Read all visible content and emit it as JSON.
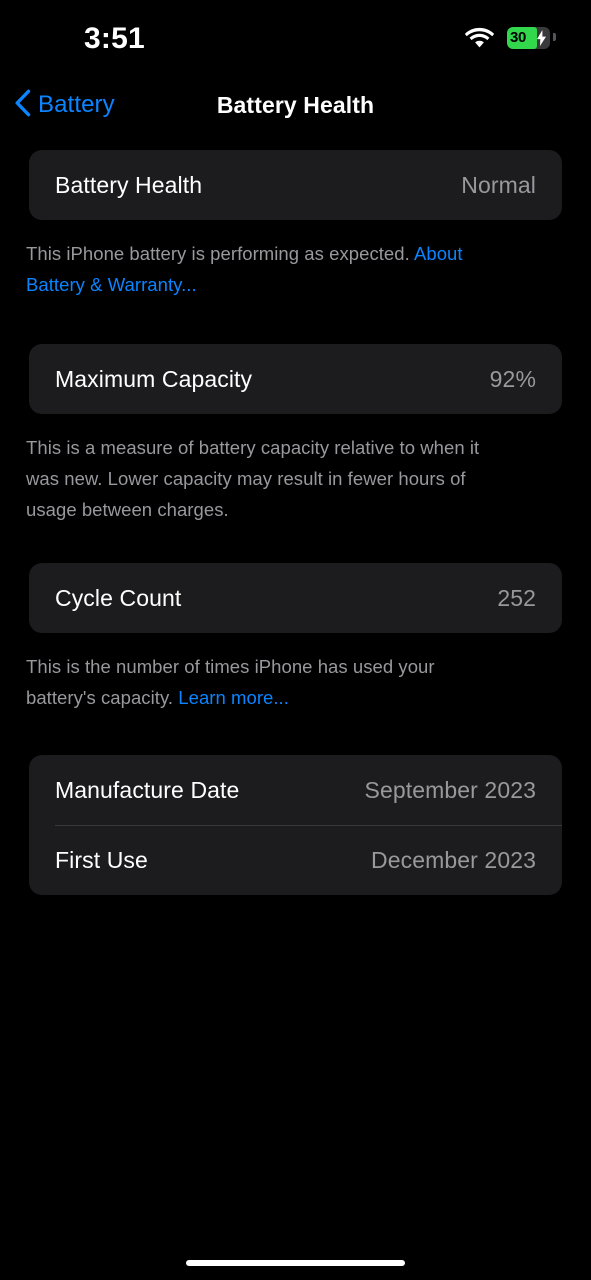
{
  "status_bar": {
    "time": "3:51",
    "wifi_icon": "wifi-icon",
    "battery": {
      "level_text": "30",
      "level_percent": 30,
      "charging": true,
      "fill_color": "#32d74b",
      "shell_color": "#3a3a3c",
      "bolt_icon": "lightning-bolt-icon"
    }
  },
  "nav": {
    "back_icon": "chevron-left-icon",
    "back_label": "Battery",
    "title": "Battery Health",
    "accent_color": "#0a84ff"
  },
  "sections": [
    {
      "rows": [
        {
          "label": "Battery Health",
          "value": "Normal"
        }
      ],
      "footer": {
        "text": "This iPhone battery is performing as expected. ",
        "link": "About Battery & Warranty..."
      }
    },
    {
      "rows": [
        {
          "label": "Maximum Capacity",
          "value": "92%"
        }
      ],
      "footer": {
        "text": "This is a measure of battery capacity relative to when it was new. Lower capacity may result in fewer hours of usage between charges.",
        "link": ""
      }
    },
    {
      "rows": [
        {
          "label": "Cycle Count",
          "value": "252"
        }
      ],
      "footer": {
        "text": "This is the number of times iPhone has used your battery's capacity. ",
        "link": "Learn more..."
      }
    },
    {
      "rows": [
        {
          "label": "Manufacture Date",
          "value": "September 2023"
        },
        {
          "label": "First Use",
          "value": "December 2023"
        }
      ],
      "footer": {
        "text": "",
        "link": ""
      }
    }
  ],
  "home_indicator": "home-indicator",
  "theme": {
    "background": "#000000",
    "card_background": "#1c1c1e",
    "primary_text": "#ffffff",
    "secondary_text": "#98989d",
    "accent": "#0a84ff",
    "separator": "#38383a"
  }
}
